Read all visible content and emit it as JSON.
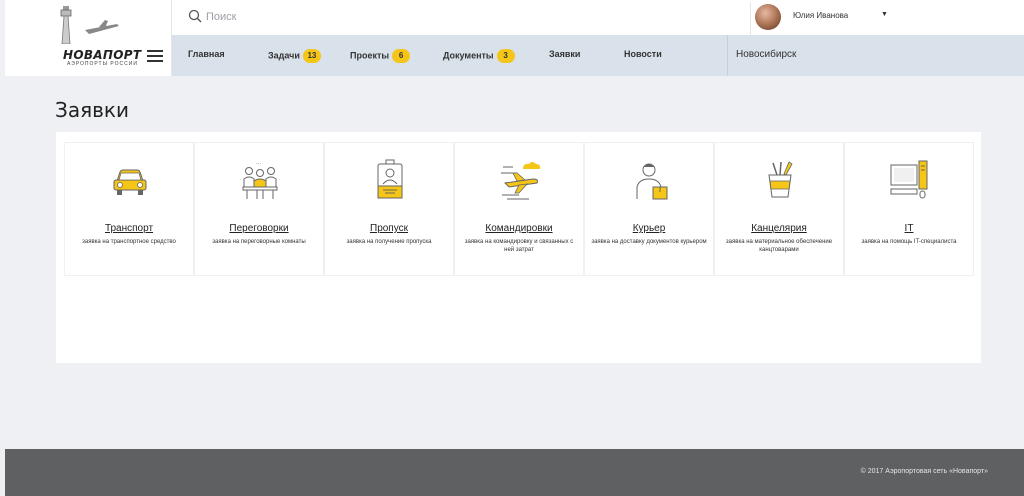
{
  "logo": {
    "name": "НОВАПОРТ",
    "tagline": "АЭРОПОРТЫ РОССИИ"
  },
  "search": {
    "placeholder": "Поиск"
  },
  "user": {
    "name": "Юлия Иванова"
  },
  "nav": {
    "items": [
      {
        "label": "Главная",
        "badge": null
      },
      {
        "label": "Задачи",
        "badge": "13"
      },
      {
        "label": "Проекты",
        "badge": "6"
      },
      {
        "label": "Документы",
        "badge": "3"
      },
      {
        "label": "Заявки",
        "badge": null
      },
      {
        "label": "Новости",
        "badge": null
      }
    ],
    "city": "Новосибирск"
  },
  "page": {
    "title": "Заявки"
  },
  "cards": [
    {
      "title": "Транспорт",
      "desc": "заявка на транспортное средство",
      "icon": "car-icon"
    },
    {
      "title": "Переговорки",
      "desc": "заявка на переговорные комнаты",
      "icon": "meeting-icon"
    },
    {
      "title": "Пропуск",
      "desc": "заявка на получение пропуска",
      "icon": "badge-icon"
    },
    {
      "title": "Командировки",
      "desc": "заявка на командировку и связанных с ней затрат",
      "icon": "airplane-icon"
    },
    {
      "title": "Курьер",
      "desc": "заявка на доставку документов курьером",
      "icon": "courier-icon"
    },
    {
      "title": "Канцелярия",
      "desc": "заявка на материальное обеспечение канцтоварами",
      "icon": "stationery-icon"
    },
    {
      "title": "IT",
      "desc": "заявка на помощь IT-специалиста",
      "icon": "computer-icon"
    }
  ],
  "footer": {
    "copyright": "© 2017 Аэропортовая сеть «Новапорт»"
  },
  "colors": {
    "accent": "#f5c518",
    "nav_bg": "#d9e1ea",
    "footer_bg": "#5f6062"
  }
}
